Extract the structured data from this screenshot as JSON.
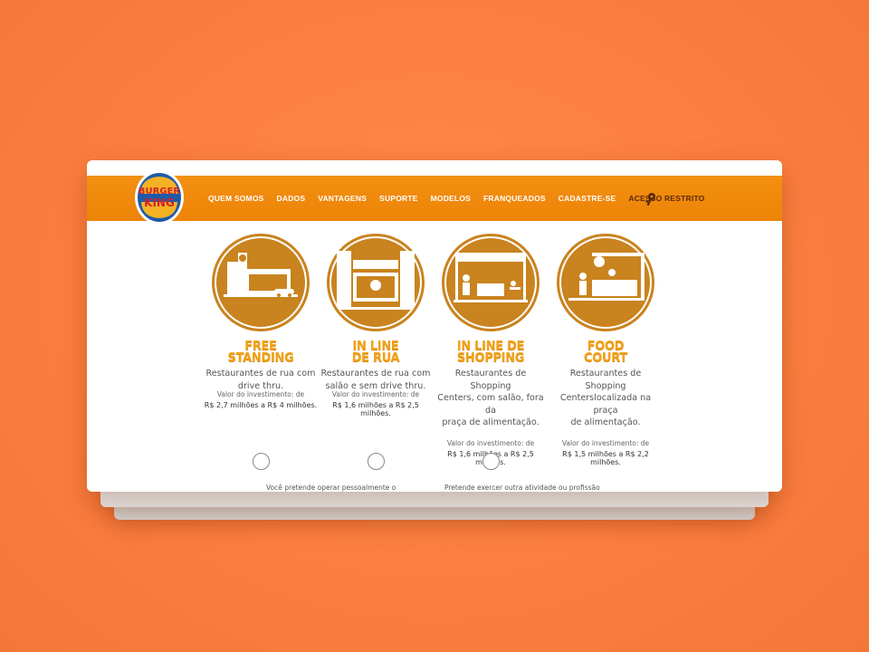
{
  "brand": {
    "logo_top": "BURGER",
    "logo_bottom": "KING",
    "colors": {
      "orange": "#f18a0c",
      "gold": "#f0a21c",
      "bronze": "#c9831f",
      "red": "#d2232a",
      "blue": "#1e5ba8"
    }
  },
  "nav": {
    "items": [
      "QUEM SOMOS",
      "DADOS",
      "VANTAGENS",
      "SUPORTE",
      "MODELOS",
      "FRANQUEADOS",
      "CADASTRE-SE"
    ],
    "restricted": "ACESSO RESTRITO",
    "restricted_icon": "key-icon"
  },
  "models": [
    {
      "title_line1": "FREE",
      "title_line2": "STANDING",
      "desc_line1": "Restaurantes de rua com",
      "desc_line2": "drive thru.",
      "desc_line3": "",
      "inv_label": "Valor do investimento: de",
      "inv_range": "R$ 2,7 milhões a R$ 4 milhões."
    },
    {
      "title_line1": "IN LINE",
      "title_line2": "DE RUA",
      "desc_line1": "Restaurantes de rua com",
      "desc_line2": "salão e sem drive thru.",
      "desc_line3": "",
      "inv_label": "Valor do investimento: de",
      "inv_range": "R$ 1,6 milhões a R$ 2,5 milhões."
    },
    {
      "title_line1": "IN LINE DE",
      "title_line2": "SHOPPING",
      "desc_line1": "Restaurantes de Shopping",
      "desc_line2": "Centers, com salão, fora da",
      "desc_line3": "praça de alimentação.",
      "inv_label": "Valor do investimento: de",
      "inv_range": "R$ 1,6 milhões a R$ 2,5 milhões."
    },
    {
      "title_line1": "FOOD",
      "title_line2": "COURT",
      "desc_line1": "Restaurantes de Shopping",
      "desc_line2": "Centerslocalizada na praça",
      "desc_line3": "de alimentação.",
      "inv_label": "Valor do investimento: de",
      "inv_range": "R$ 1,5 milhões a R$ 2,2 milhões."
    }
  ],
  "form": {
    "question1": "Você pretende operar pessoalmente o",
    "question2": "Pretende exercer outra atividade ou profissão"
  }
}
